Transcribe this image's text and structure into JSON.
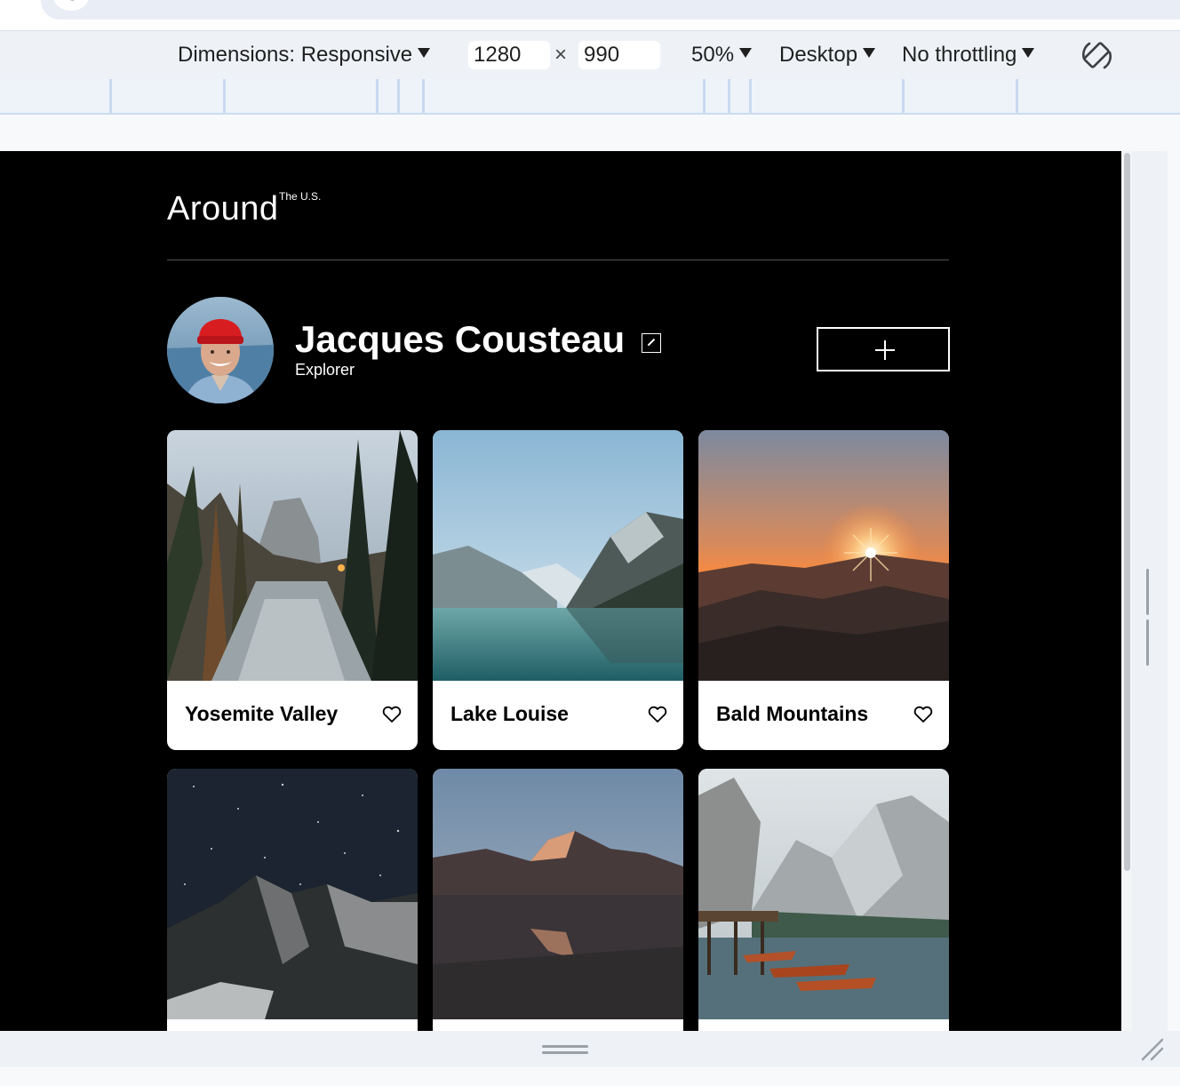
{
  "devtools": {
    "dimensions_label": "Dimensions: Responsive",
    "width_value": "1280",
    "height_value": "990",
    "times_symbol": "×",
    "zoom": "50%",
    "device_type": "Desktop",
    "throttling": "No throttling"
  },
  "page": {
    "logo": {
      "main": "Around",
      "sup": "The U.S."
    },
    "profile": {
      "name": "Jacques Cousteau",
      "role": "Explorer"
    },
    "cards": [
      {
        "title": "Yosemite Valley"
      },
      {
        "title": "Lake Louise"
      },
      {
        "title": "Bald Mountains"
      },
      {
        "title": ""
      },
      {
        "title": ""
      },
      {
        "title": ""
      }
    ]
  },
  "icons": {
    "rotate": "rotate-icon",
    "edit": "pencil-icon",
    "add": "plus-icon",
    "like": "heart-icon"
  },
  "colors": {
    "page_background": "#000000",
    "card_background": "#ffffff",
    "text_on_dark": "#ffffff"
  }
}
